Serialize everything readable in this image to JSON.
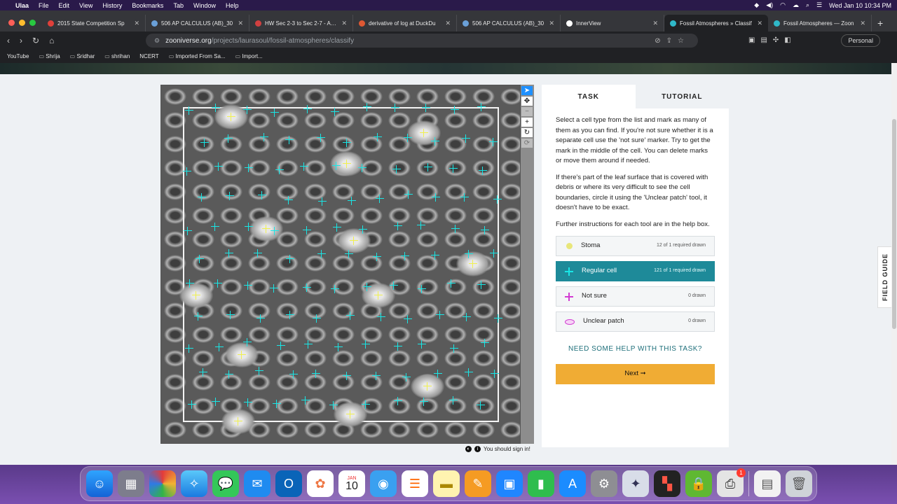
{
  "menubar": {
    "app_name": "Ulaa",
    "items": [
      "File",
      "Edit",
      "View",
      "History",
      "Bookmarks",
      "Tab",
      "Window",
      "Help"
    ],
    "datetime": "Wed Jan 10  10:34 PM"
  },
  "browser": {
    "tabs": [
      {
        "title": "2015 State Competition Sp",
        "color": "#e0403a"
      },
      {
        "title": "506 AP CALCULUS (AB)_30",
        "color": "#6aa0d8"
      },
      {
        "title": "HW Sec 2-3 to Sec 2-7 - AP C",
        "color": "#d04040"
      },
      {
        "title": "derivative of log at DuckDu",
        "color": "#de5833"
      },
      {
        "title": "506 AP CALCULUS (AB)_30",
        "color": "#6aa0d8"
      },
      {
        "title": "InnerView",
        "color": "#ffffff"
      },
      {
        "title": "Fossil Atmospheres » Classif",
        "color": "#2fb8c8",
        "active": true
      },
      {
        "title": "Fossil Atmospheres — Zoon",
        "color": "#2fb8c8"
      }
    ],
    "url_host": "zooniverse.org",
    "url_path": "/projects/laurasoul/fossil-atmospheres/classify",
    "profile_label": "Personal",
    "bookmarks": [
      "YouTube",
      "Shrija",
      "Sridhar",
      "shrihan",
      "NCERT",
      "Imported From Sa...",
      "Import..."
    ]
  },
  "task_panel": {
    "tabs": {
      "task": "TASK",
      "tutorial": "TUTORIAL"
    },
    "instructions": [
      "Select a cell type from the list and mark as many of them as you can find. If you're not sure whether it is a separate cell use the 'not sure' marker. Try to get the mark in the middle of the cell. You can delete marks or move them around if needed.",
      "If there's part of the leaf surface that is covered with debris or where its very difficult to see the cell boundaries, circle it using the 'Unclear patch' tool, it doesn't have to be exact.",
      "Further instructions for each tool are in the help box."
    ],
    "answers": [
      {
        "label": "Stoma",
        "count": "12 of 1 required drawn",
        "icon": "dot-icon"
      },
      {
        "label": "Regular cell",
        "count": "121 of 1 required drawn",
        "icon": "crosshair-icon",
        "selected": true
      },
      {
        "label": "Not sure",
        "count": "0 drawn",
        "icon": "crosshair-icon"
      },
      {
        "label": "Unclear patch",
        "count": "0 drawn",
        "icon": "ellipse-icon"
      }
    ],
    "help_link": "NEED SOME HELP WITH THIS TASK?",
    "next_label": "Next ➞"
  },
  "field_guide_label": "FIELD GUIDE",
  "signin_text": "You should sign in!",
  "colors": {
    "regular_cell_marker": "#19e6e6",
    "stoma_marker": "#f0f050",
    "not_sure_marker": "#d23bd2",
    "selected_answer": "#1e8a99",
    "next_button": "#f0ac34"
  },
  "dock": {
    "calendar_month": "JAN",
    "calendar_day": "10",
    "printer_badge": "1"
  }
}
